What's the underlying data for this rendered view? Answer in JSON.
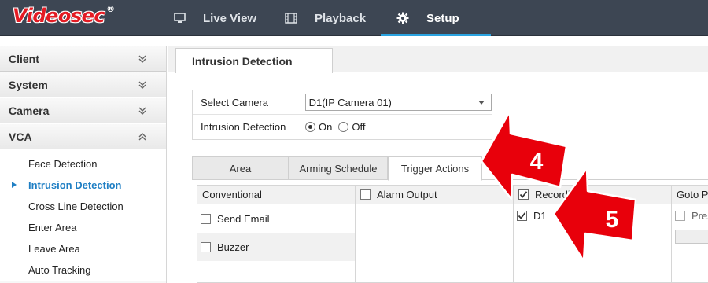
{
  "header": {
    "logo_text": "Videosec",
    "logo_mark": "®",
    "nav": [
      {
        "label": "Live View",
        "icon": "monitor-icon"
      },
      {
        "label": "Playback",
        "icon": "film-icon"
      },
      {
        "label": "Setup",
        "icon": "gear-icon"
      }
    ],
    "active_nav": "Setup",
    "accent_color": "#2aa3e0"
  },
  "sidebar": {
    "sections": [
      {
        "label": "Client",
        "expanded": false
      },
      {
        "label": "System",
        "expanded": false
      },
      {
        "label": "Camera",
        "expanded": false
      },
      {
        "label": "VCA",
        "expanded": true
      }
    ],
    "vca_items": [
      {
        "label": "Face Detection"
      },
      {
        "label": "Intrusion Detection",
        "active": true
      },
      {
        "label": "Cross Line Detection"
      },
      {
        "label": "Enter Area"
      },
      {
        "label": "Leave Area"
      },
      {
        "label": "Auto Tracking"
      }
    ]
  },
  "main": {
    "page_tab": "Intrusion Detection",
    "form": {
      "camera_label": "Select Camera",
      "camera_value": "D1(IP Camera 01)",
      "detection_label": "Intrusion Detection",
      "on_label": "On",
      "off_label": "Off",
      "detection_on": true
    },
    "subtabs": [
      {
        "label": "Area"
      },
      {
        "label": "Arming Schedule"
      },
      {
        "label": "Trigger Actions",
        "active": true
      }
    ],
    "actions": {
      "conventional_header": "Conventional",
      "send_email_label": "Send Email",
      "send_email_checked": false,
      "buzzer_label": "Buzzer",
      "buzzer_checked": false,
      "alarm_output_header": "Alarm Output",
      "alarm_output_checked": false,
      "recording_header": "Recording",
      "recording_checked": true,
      "d1_label": "D1",
      "d1_checked": true,
      "goto_preset_header": "Goto Pre",
      "preset_label": "Prese",
      "preset_checked": false
    }
  },
  "annotations": [
    {
      "label": "4",
      "color": "#e8000b"
    },
    {
      "label": "5",
      "color": "#e8000b"
    }
  ]
}
